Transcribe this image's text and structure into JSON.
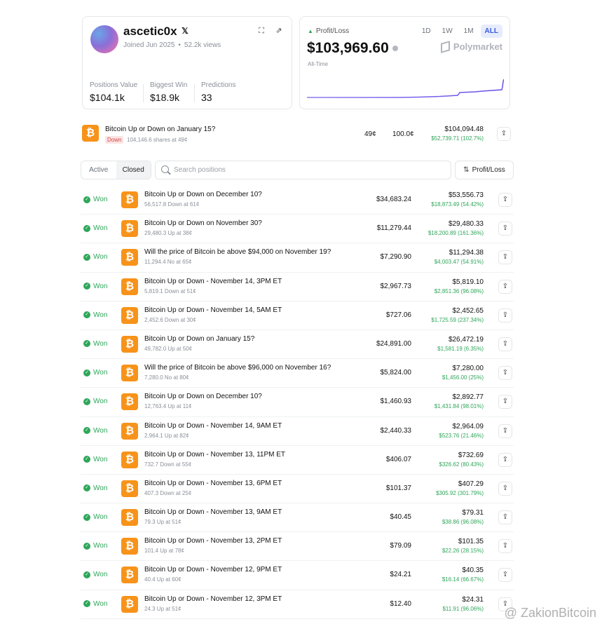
{
  "profile": {
    "username": "ascetic0x",
    "joined": "Joined Jun 2025",
    "views": "52.2k views",
    "stats": [
      {
        "label": "Positions Value",
        "value": "$104.1k"
      },
      {
        "label": "Biggest Win",
        "value": "$18.9k"
      },
      {
        "label": "Predictions",
        "value": "33"
      }
    ]
  },
  "pnl": {
    "label": "Profit/Loss",
    "amount": "$103,969.60",
    "period": "All-Time",
    "ranges": [
      "1D",
      "1W",
      "1M",
      "ALL"
    ],
    "active_range": "ALL",
    "brand": "Polymarket",
    "accent": "#7b61ff"
  },
  "open_position": {
    "title": "Bitcoin Up or Down on January 15?",
    "outcome": "Down",
    "shares": "104,146.6 shares at 49¢",
    "avg": "49¢",
    "current": "100.0¢",
    "value": "$104,094.48",
    "pnl": "$52,739.71 (102.7%)"
  },
  "filters": {
    "tabs": [
      "Active",
      "Closed"
    ],
    "active_tab": "Closed",
    "search_placeholder": "Search positions",
    "sort_label": "Profit/Loss"
  },
  "positions": [
    {
      "status": "Won",
      "title": "Bitcoin Up or Down on December 10?",
      "sub": "56,517.8 Down at 61¢",
      "bet": "$34,683.24",
      "value": "$53,556.73",
      "pnl": "$18,873.49 (54.42%)"
    },
    {
      "status": "Won",
      "title": "Bitcoin Up or Down on November 30?",
      "sub": "29,480.3 Up at 38¢",
      "bet": "$11,279.44",
      "value": "$29,480.33",
      "pnl": "$18,200.89 (161.36%)"
    },
    {
      "status": "Won",
      "title": "Will the price of Bitcoin be above $94,000 on November 19?",
      "sub": "11,294.4 No at 65¢",
      "bet": "$7,290.90",
      "value": "$11,294.38",
      "pnl": "$4,003.47 (54.91%)"
    },
    {
      "status": "Won",
      "title": "Bitcoin Up or Down - November 14, 3PM ET",
      "sub": "5,819.1 Down at 51¢",
      "bet": "$2,967.73",
      "value": "$5,819.10",
      "pnl": "$2,851.36 (96.08%)"
    },
    {
      "status": "Won",
      "title": "Bitcoin Up or Down - November 14, 5AM ET",
      "sub": "2,452.6 Down at 30¢",
      "bet": "$727.06",
      "value": "$2,452.65",
      "pnl": "$1,725.59 (237.34%)"
    },
    {
      "status": "Won",
      "title": "Bitcoin Up or Down on January 15?",
      "sub": "49,782.0 Up at 50¢",
      "bet": "$24,891.00",
      "value": "$26,472.19",
      "pnl": "$1,581.19 (6.35%)"
    },
    {
      "status": "Won",
      "title": "Will the price of Bitcoin be above $96,000 on November 16?",
      "sub": "7,280.0 No at 80¢",
      "bet": "$5,824.00",
      "value": "$7,280.00",
      "pnl": "$1,456.00 (25%)"
    },
    {
      "status": "Won",
      "title": "Bitcoin Up or Down on December 10?",
      "sub": "12,763.4 Up at 11¢",
      "bet": "$1,460.93",
      "value": "$2,892.77",
      "pnl": "$1,431.84 (98.01%)"
    },
    {
      "status": "Won",
      "title": "Bitcoin Up or Down - November 14, 9AM ET",
      "sub": "2,964.1 Up at 82¢",
      "bet": "$2,440.33",
      "value": "$2,964.09",
      "pnl": "$523.76 (21.46%)"
    },
    {
      "status": "Won",
      "title": "Bitcoin Up or Down - November 13, 11PM ET",
      "sub": "732.7 Down at 55¢",
      "bet": "$406.07",
      "value": "$732.69",
      "pnl": "$326.62 (80.43%)"
    },
    {
      "status": "Won",
      "title": "Bitcoin Up or Down - November 13, 6PM ET",
      "sub": "407.3 Down at 25¢",
      "bet": "$101.37",
      "value": "$407.29",
      "pnl": "$305.92 (301.79%)"
    },
    {
      "status": "Won",
      "title": "Bitcoin Up or Down - November 13, 9AM ET",
      "sub": "79.3 Up at 51¢",
      "bet": "$40.45",
      "value": "$79.31",
      "pnl": "$38.86 (96.08%)"
    },
    {
      "status": "Won",
      "title": "Bitcoin Up or Down - November 13, 2PM ET",
      "sub": "101.4 Up at 78¢",
      "bet": "$79.09",
      "value": "$101.35",
      "pnl": "$22.26 (28.15%)"
    },
    {
      "status": "Won",
      "title": "Bitcoin Up or Down - November 12, 9PM ET",
      "sub": "40.4 Up at 60¢",
      "bet": "$24.21",
      "value": "$40.35",
      "pnl": "$16.14 (66.67%)"
    },
    {
      "status": "Won",
      "title": "Bitcoin Up or Down - November 12, 3PM ET",
      "sub": "24.3 Up at 51¢",
      "bet": "$12.40",
      "value": "$24.31",
      "pnl": "$11.91 (96.06%)"
    }
  ],
  "watermark": "@ ZakionBitcoin"
}
